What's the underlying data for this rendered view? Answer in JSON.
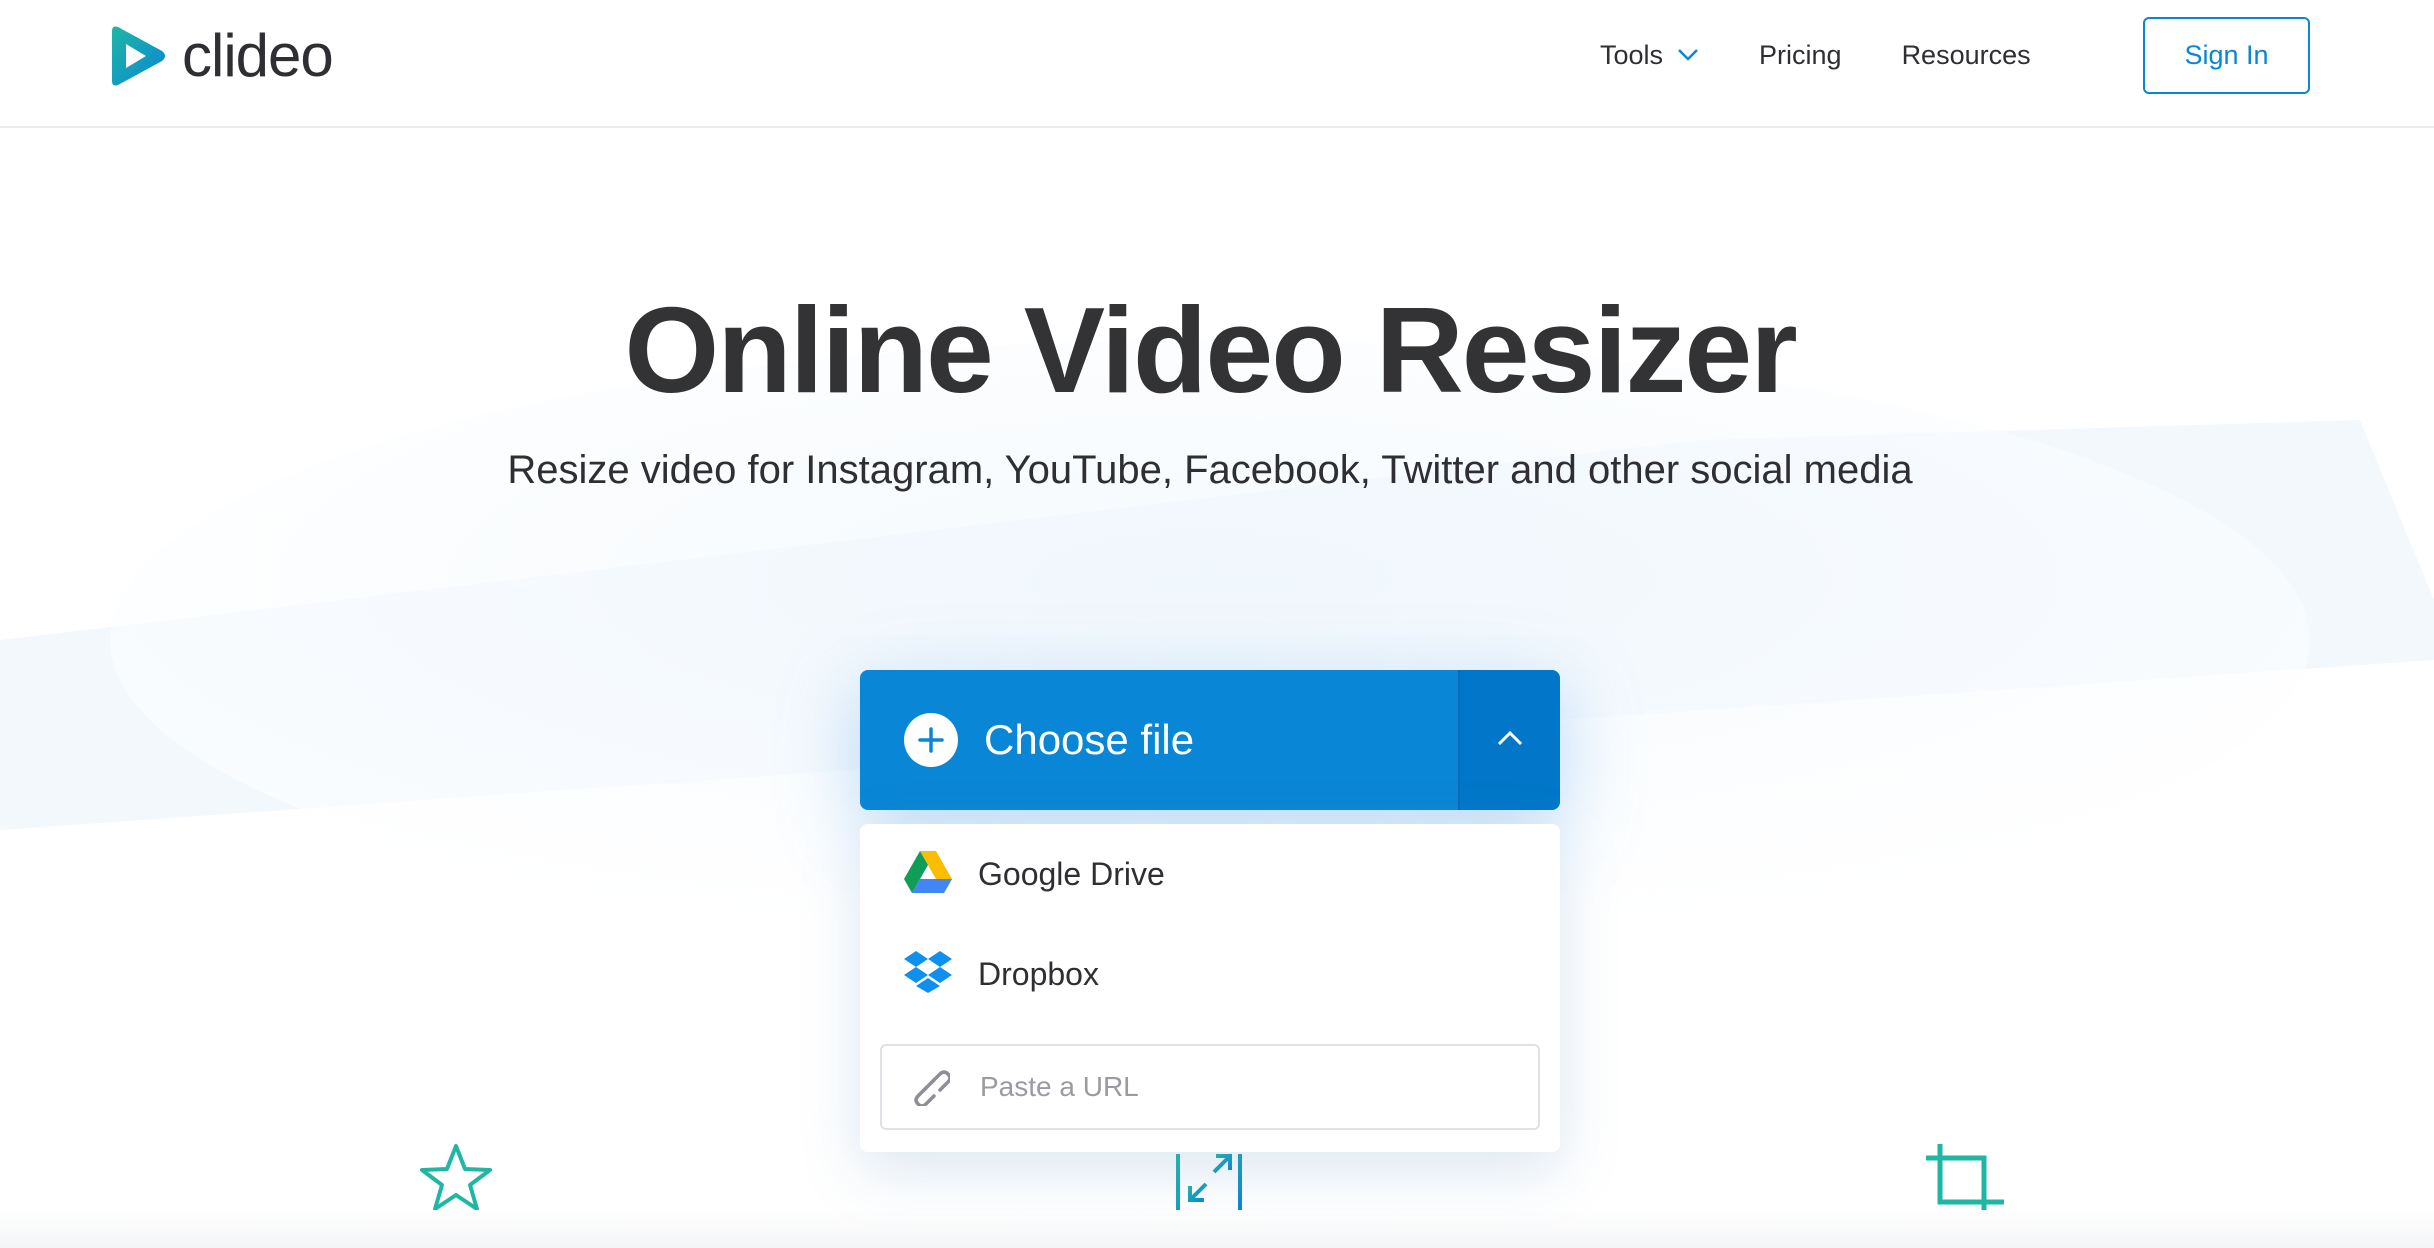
{
  "brand": {
    "name": "clideo",
    "color_start": "#1fb7a4",
    "color_end": "#0a86d6"
  },
  "nav": {
    "tools_label": "Tools",
    "pricing_label": "Pricing",
    "resources_label": "Resources",
    "signin_label": "Sign In"
  },
  "hero": {
    "title": "Online Video Resizer",
    "subtitle": "Resize video for Instagram, YouTube, Facebook, Twitter and other social media"
  },
  "upload": {
    "choose_label": "Choose file",
    "accent": "#0a86d6",
    "sources": [
      {
        "label": "Google Drive",
        "icon": "google-drive-icon"
      },
      {
        "label": "Dropbox",
        "icon": "dropbox-icon"
      }
    ],
    "url_placeholder": "Paste a URL"
  },
  "features": [
    {
      "icon": "star-icon"
    },
    {
      "icon": "resize-arrows-icon"
    },
    {
      "icon": "crop-icon"
    }
  ]
}
